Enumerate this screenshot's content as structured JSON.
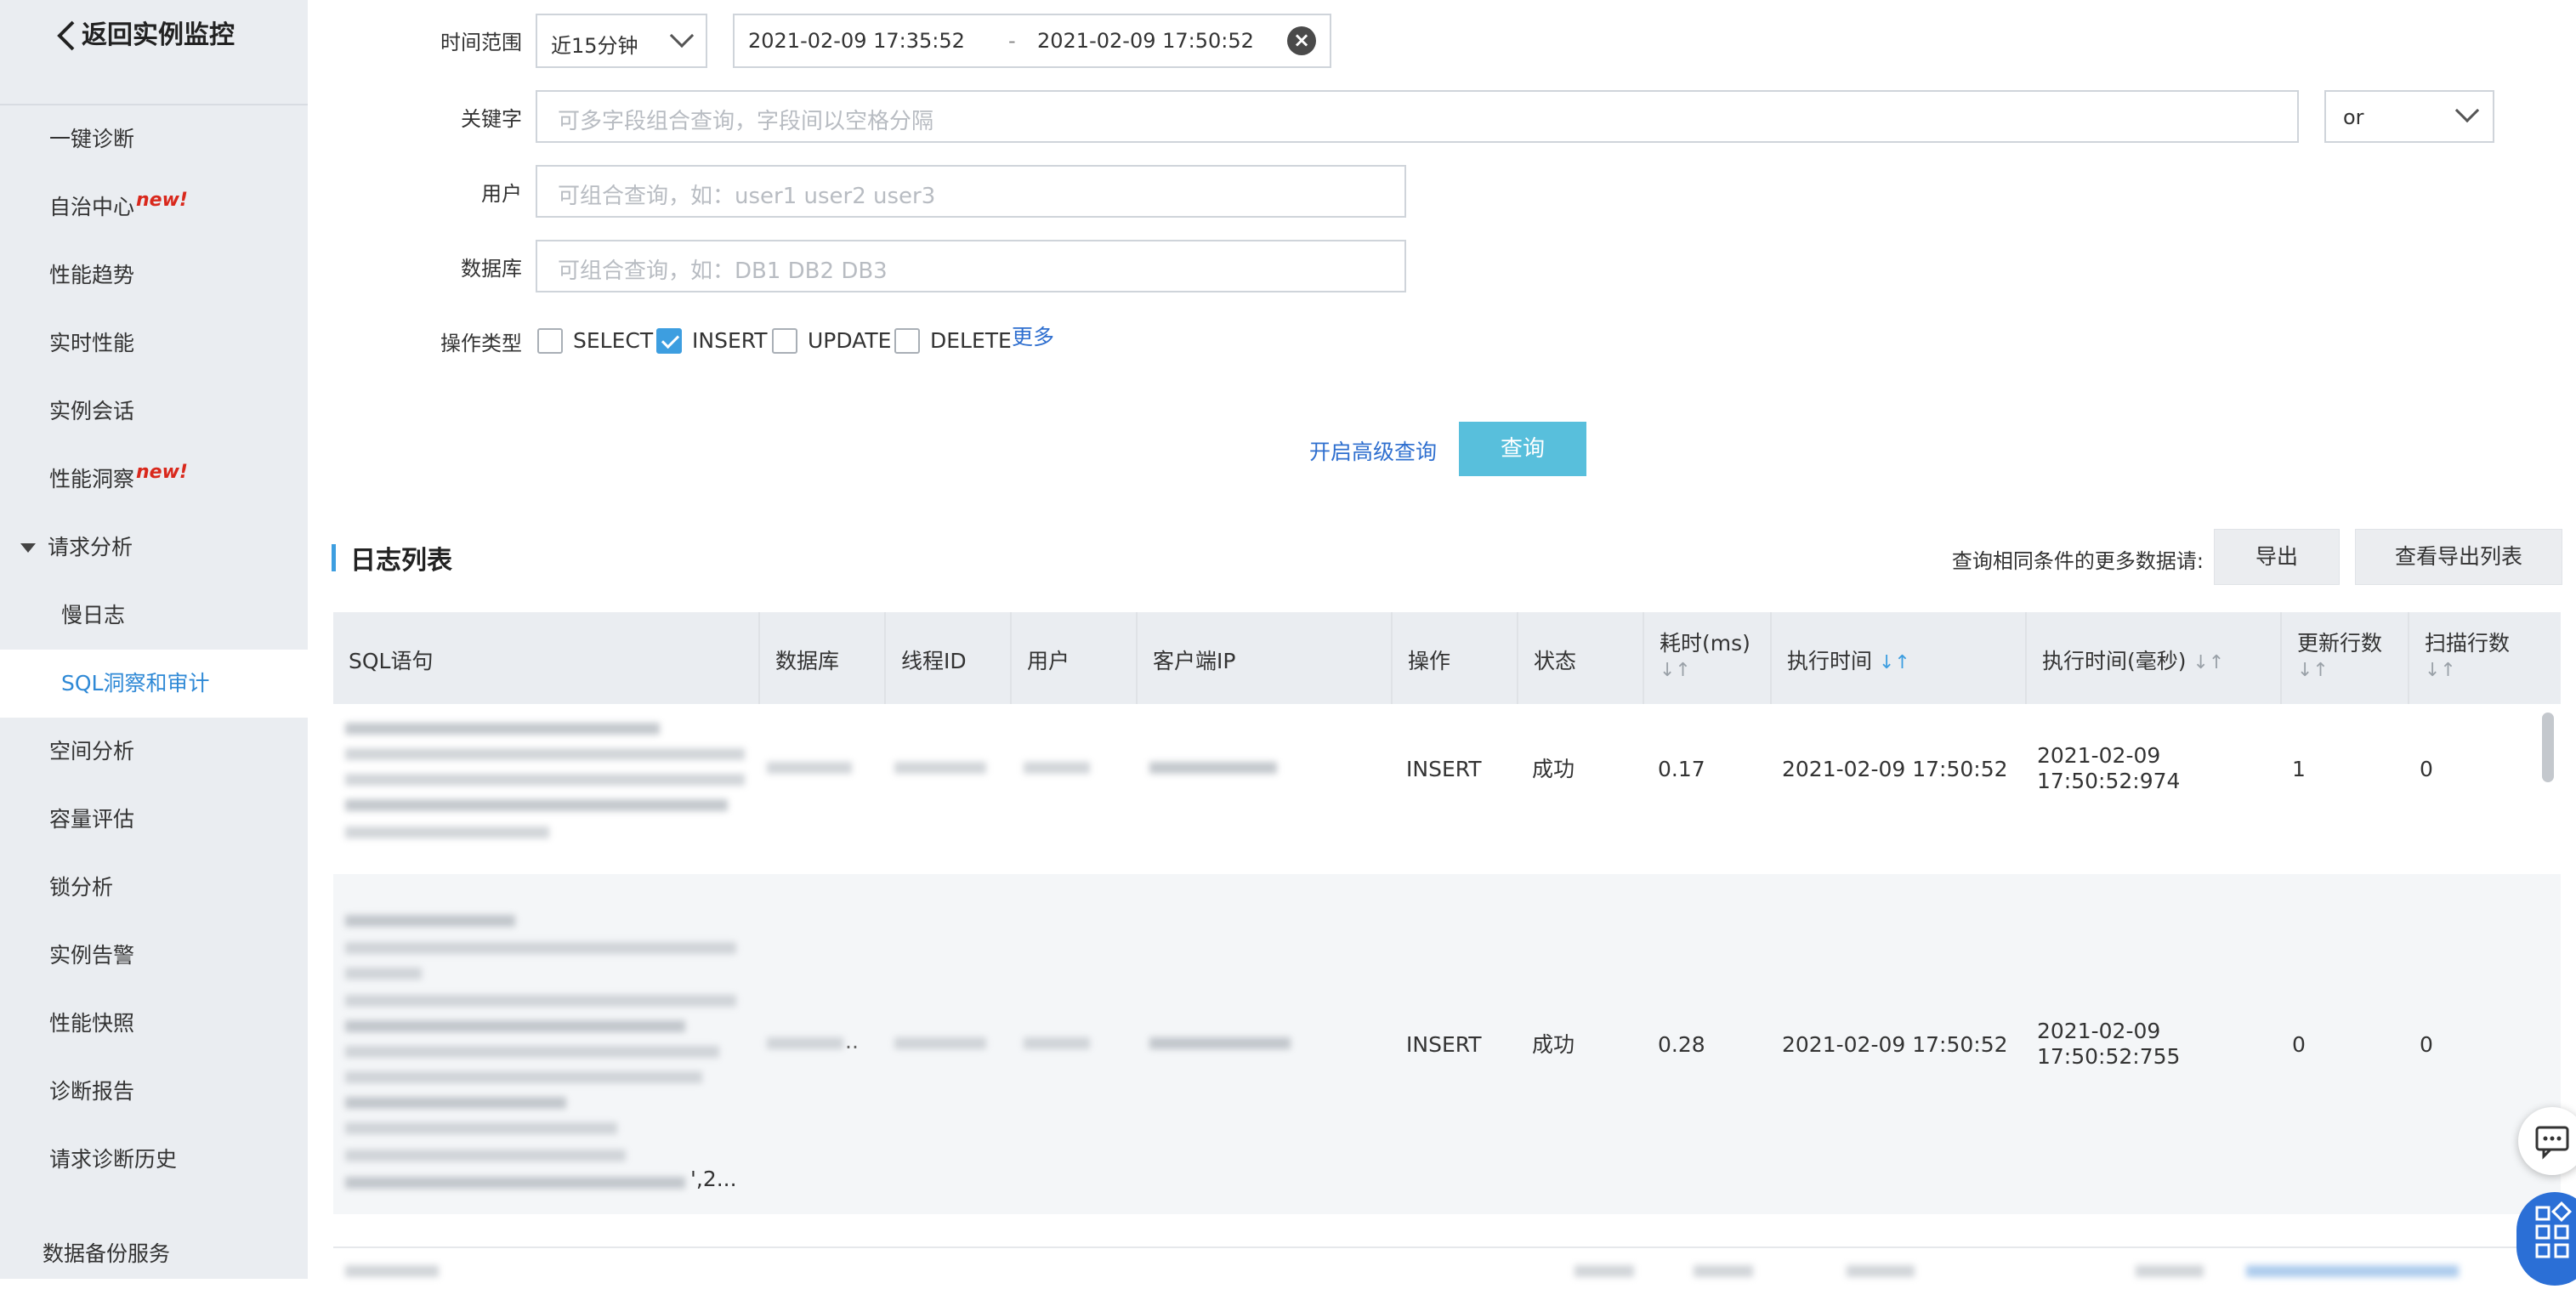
{
  "sidebar": {
    "back_label": "返回实例监控",
    "items": [
      {
        "label": "一键诊断",
        "badge": ""
      },
      {
        "label": "自治中心",
        "badge": "new!"
      },
      {
        "label": "性能趋势",
        "badge": ""
      },
      {
        "label": "实时性能",
        "badge": ""
      },
      {
        "label": "实例会话",
        "badge": ""
      },
      {
        "label": "性能洞察",
        "badge": "new!"
      },
      {
        "label": "请求分析",
        "badge": ""
      },
      {
        "label": "慢日志",
        "badge": ""
      },
      {
        "label": "SQL洞察和审计",
        "badge": ""
      },
      {
        "label": "空间分析",
        "badge": ""
      },
      {
        "label": "容量评估",
        "badge": ""
      },
      {
        "label": "锁分析",
        "badge": ""
      },
      {
        "label": "实例告警",
        "badge": ""
      },
      {
        "label": "性能快照",
        "badge": ""
      },
      {
        "label": "诊断报告",
        "badge": ""
      },
      {
        "label": "请求诊断历史",
        "badge": ""
      }
    ],
    "bottom_label": "数据备份服务"
  },
  "form": {
    "time_range_label": "时间范围",
    "time_range_selected": "近15分钟",
    "time_start": "2021-02-09 17:35:52",
    "time_sep": "-",
    "time_end": "2021-02-09 17:50:52",
    "keyword_label": "关键字",
    "keyword_placeholder": "可多字段组合查询，字段间以空格分隔",
    "logic_selected": "or",
    "user_label": "用户",
    "user_placeholder": "可组合查询，如：user1 user2 user3",
    "db_label": "数据库",
    "db_placeholder": "可组合查询，如：DB1 DB2 DB3",
    "op_label": "操作类型",
    "ops": [
      {
        "label": "SELECT",
        "checked": false
      },
      {
        "label": "INSERT",
        "checked": true
      },
      {
        "label": "UPDATE",
        "checked": false
      },
      {
        "label": "DELETE",
        "checked": false
      }
    ],
    "more_link": "更多",
    "advanced_link": "开启高级查询",
    "query_button": "查询"
  },
  "log_list": {
    "title": "日志列表",
    "more_data_text": "查询相同条件的更多数据请:",
    "export_button": "导出",
    "view_export_button": "查看导出列表",
    "columns": [
      "SQL语句",
      "数据库",
      "线程ID",
      "用户",
      "客户端IP",
      "操作",
      "状态",
      "耗时(ms)",
      "执行时间",
      "执行时间(毫秒)",
      "更新行数",
      "扫描行数"
    ],
    "rows": [
      {
        "operation": "INSERT",
        "status": "成功",
        "duration": "0.17",
        "exec_time": "2021-02-09 17:50:52",
        "exec_time_ms_date": "2021-02-09",
        "exec_time_ms_time": "17:50:52:974",
        "updated": "1",
        "scanned": "0"
      },
      {
        "operation": "INSERT",
        "status": "成功",
        "duration": "0.28",
        "exec_time": "2021-02-09 17:50:52",
        "exec_time_ms_date": "2021-02-09",
        "exec_time_ms_time": "17:50:52:755",
        "updated": "0",
        "scanned": "0",
        "sql_tail": "',2..."
      }
    ]
  },
  "icons": {
    "back": "chevron-left-icon",
    "clear": "clear-circle-icon",
    "sort": "sort-icon",
    "chat": "chat-icon",
    "apps": "apps-icon"
  },
  "colors": {
    "accent": "#3d9ee0",
    "query_button": "#58bfdc",
    "link": "#2f6fcf",
    "new_badge": "#d9281c",
    "sidebar_bg": "#eaedf1"
  }
}
